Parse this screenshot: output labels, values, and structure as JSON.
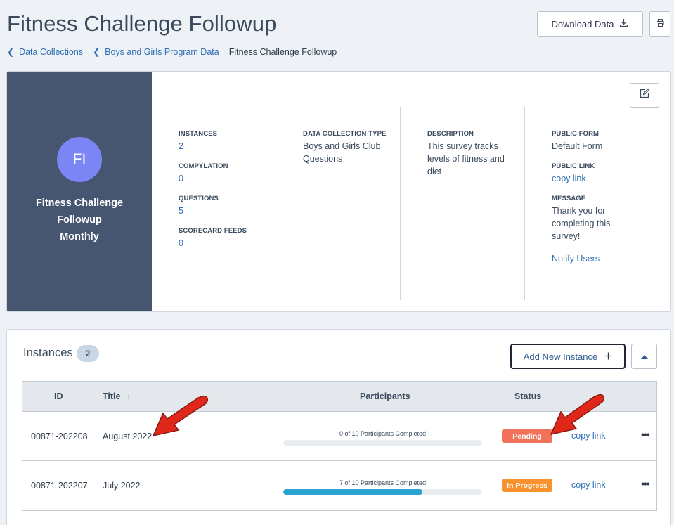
{
  "page": {
    "title": "Fitness Challenge Followup"
  },
  "header": {
    "download_label": "Download Data",
    "download_icon": "download-icon",
    "print_icon": "print-icon"
  },
  "breadcrumb": {
    "items": [
      "Data Collections",
      "Boys and Girls Program Data"
    ],
    "current": "Fitness Challenge Followup"
  },
  "summary": {
    "avatar_initials": "FI",
    "avatar_color": "#7b86f4",
    "panel_color": "#465570",
    "name": "Fitness Challenge Followup",
    "frequency": "Monthly",
    "stats": [
      {
        "label": "INSTANCES",
        "value": "2"
      },
      {
        "label": "COMPYLATION",
        "value": "0"
      },
      {
        "label": "QUESTIONS",
        "value": "5"
      },
      {
        "label": "SCORECARD FEEDS",
        "value": "0"
      }
    ],
    "type_label": "DATA COLLECTION TYPE",
    "type_value": "Boys and Girls Club Questions",
    "description_label": "DESCRIPTION",
    "description_value": "This survey tracks levels of fitness and diet",
    "public_form_label": "PUBLIC FORM",
    "public_form_value": "Default Form",
    "public_link_label": "PUBLIC LINK",
    "public_link_value": "copy link",
    "message_label": "MESSAGE",
    "message_value": "Thank you for completing this survey!",
    "notify_label": "Notify Users"
  },
  "instances": {
    "title": "Instances",
    "count": "2",
    "add_label": "Add New Instance",
    "columns": {
      "id": "ID",
      "title": "Title",
      "sort_glyph": "↑",
      "participants": "Participants",
      "status": "Status"
    },
    "rows": [
      {
        "id": "00871-202208",
        "title": "August 2022",
        "progress_text": "0 of 10 Participants Completed",
        "progress": 0.0,
        "status": "Pending",
        "status_color": "#f2715a",
        "link": "copy link",
        "more": "•••"
      },
      {
        "id": "00871-202207",
        "title": "July 2022",
        "progress_text": "7 of 10 Participants Completed",
        "progress": 0.7,
        "status": "In Progress",
        "status_color": "#f7922f",
        "link": "copy link",
        "more": "•••"
      }
    ]
  },
  "annotation": {
    "arrow_color": "#e0281a"
  }
}
